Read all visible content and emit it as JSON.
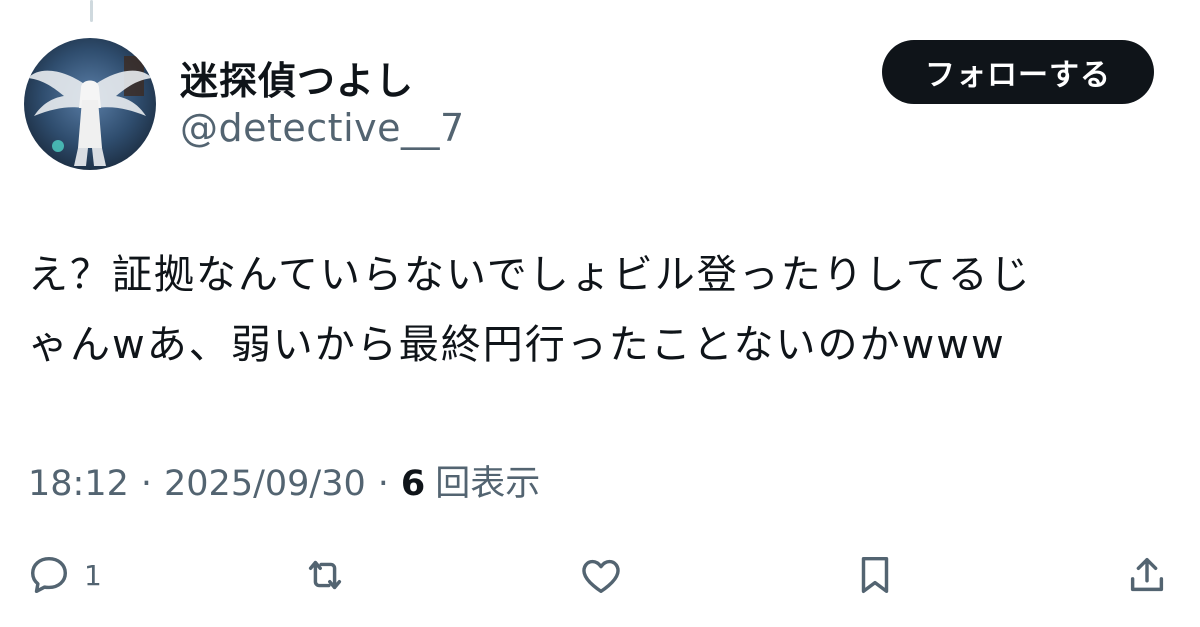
{
  "tweet": {
    "display_name": "迷探偵つよし",
    "handle": "@detective__7",
    "follow_label": "フォローする",
    "text_lines": [
      "え？証拠なんていらないでしょビル登ったりしてるじ",
      "ゃんwあ、弱いから最終円行ったことないのかwww"
    ],
    "time": "18:12",
    "separator": "·",
    "date": "2025/09/30",
    "views_count": "6",
    "views_label": "回表示"
  },
  "actions": {
    "reply_count": "1",
    "reply_icon": "speech-bubble-icon",
    "retweet_icon": "retweet-arrows-icon",
    "like_icon": "heart-icon",
    "bookmark_icon": "bookmark-icon",
    "share_icon": "upload-share-icon"
  },
  "colors": {
    "text_primary": "#0f1419",
    "text_secondary": "#536471",
    "button_background": "#0f1419",
    "button_text": "#ffffff",
    "thread_line": "#cfd9de"
  }
}
